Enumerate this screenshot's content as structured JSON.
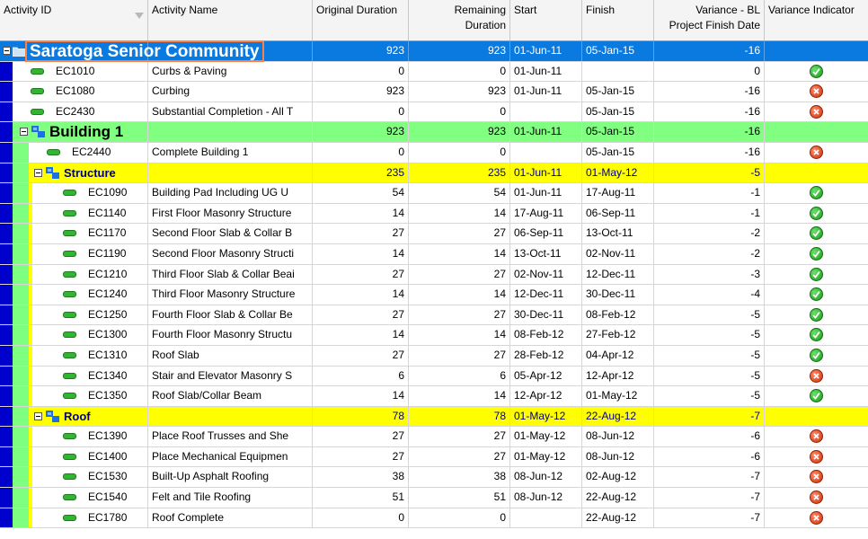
{
  "headers": {
    "activity_id": "Activity ID",
    "activity_name": "Activity Name",
    "original_duration": "Original Duration",
    "remaining_duration_1": "Remaining",
    "remaining_duration_2": "Duration",
    "start": "Start",
    "finish": "Finish",
    "variance_1": "Variance - BL",
    "variance_2": "Project Finish Date",
    "variance_indicator": "Variance Indicator"
  },
  "colors": {
    "project_band": "#0a79e0",
    "wbs1_band": "#80ff80",
    "wbs2_band": "#ffff00",
    "indicator_ok": "#22aa22",
    "indicator_bad": "#e0451a"
  },
  "rows": [
    {
      "type": "project",
      "id": "Saratoga Senior Community",
      "name": "",
      "od": "923",
      "rd": "923",
      "start": "01-Jun-11",
      "finish": "05-Jan-15",
      "var": "-16",
      "ind": ""
    },
    {
      "type": "activity",
      "level": 1,
      "id": "EC1010",
      "name": "Curbs & Paving",
      "od": "0",
      "rd": "0",
      "start": "01-Jun-11",
      "finish": "",
      "var": "0",
      "ind": "ok"
    },
    {
      "type": "activity",
      "level": 1,
      "id": "EC1080",
      "name": "Curbing",
      "od": "923",
      "rd": "923",
      "start": "01-Jun-11",
      "finish": "05-Jan-15",
      "var": "-16",
      "ind": "bad"
    },
    {
      "type": "activity",
      "level": 1,
      "id": "EC2430",
      "name": "Substantial Completion - All T",
      "od": "0",
      "rd": "0",
      "start": "",
      "finish": "05-Jan-15",
      "var": "-16",
      "ind": "bad"
    },
    {
      "type": "wbs1",
      "id": "Building 1",
      "name": "",
      "od": "923",
      "rd": "923",
      "start": "01-Jun-11",
      "finish": "05-Jan-15",
      "var": "-16",
      "ind": ""
    },
    {
      "type": "activity",
      "level": 2,
      "id": "EC2440",
      "name": "Complete Building 1",
      "od": "0",
      "rd": "0",
      "start": "",
      "finish": "05-Jan-15",
      "var": "-16",
      "ind": "bad"
    },
    {
      "type": "wbs2",
      "id": "Structure",
      "name": "",
      "od": "235",
      "rd": "235",
      "start": "01-Jun-11",
      "finish": "01-May-12",
      "var": "-5",
      "ind": ""
    },
    {
      "type": "activity",
      "level": 3,
      "id": "EC1090",
      "name": "Building Pad Including UG U",
      "od": "54",
      "rd": "54",
      "start": "01-Jun-11",
      "finish": "17-Aug-11",
      "var": "-1",
      "ind": "ok"
    },
    {
      "type": "activity",
      "level": 3,
      "id": "EC1140",
      "name": "First Floor Masonry Structure",
      "od": "14",
      "rd": "14",
      "start": "17-Aug-11",
      "finish": "06-Sep-11",
      "var": "-1",
      "ind": "ok"
    },
    {
      "type": "activity",
      "level": 3,
      "id": "EC1170",
      "name": "Second Floor Slab & Collar B",
      "od": "27",
      "rd": "27",
      "start": "06-Sep-11",
      "finish": "13-Oct-11",
      "var": "-2",
      "ind": "ok"
    },
    {
      "type": "activity",
      "level": 3,
      "id": "EC1190",
      "name": "Second Floor Masonry Structi",
      "od": "14",
      "rd": "14",
      "start": "13-Oct-11",
      "finish": "02-Nov-11",
      "var": "-2",
      "ind": "ok"
    },
    {
      "type": "activity",
      "level": 3,
      "id": "EC1210",
      "name": "Third Floor Slab & Collar Beai",
      "od": "27",
      "rd": "27",
      "start": "02-Nov-11",
      "finish": "12-Dec-11",
      "var": "-3",
      "ind": "ok"
    },
    {
      "type": "activity",
      "level": 3,
      "id": "EC1240",
      "name": "Third Floor Masonry Structure",
      "od": "14",
      "rd": "14",
      "start": "12-Dec-11",
      "finish": "30-Dec-11",
      "var": "-4",
      "ind": "ok"
    },
    {
      "type": "activity",
      "level": 3,
      "id": "EC1250",
      "name": "Fourth Floor Slab & Collar Be",
      "od": "27",
      "rd": "27",
      "start": "30-Dec-11",
      "finish": "08-Feb-12",
      "var": "-5",
      "ind": "ok"
    },
    {
      "type": "activity",
      "level": 3,
      "id": "EC1300",
      "name": "Fourth Floor Masonry Structu",
      "od": "14",
      "rd": "14",
      "start": "08-Feb-12",
      "finish": "27-Feb-12",
      "var": "-5",
      "ind": "ok"
    },
    {
      "type": "activity",
      "level": 3,
      "id": "EC1310",
      "name": "Roof Slab",
      "od": "27",
      "rd": "27",
      "start": "28-Feb-12",
      "finish": "04-Apr-12",
      "var": "-5",
      "ind": "ok"
    },
    {
      "type": "activity",
      "level": 3,
      "id": "EC1340",
      "name": "Stair and Elevator Masonry S",
      "od": "6",
      "rd": "6",
      "start": "05-Apr-12",
      "finish": "12-Apr-12",
      "var": "-5",
      "ind": "bad"
    },
    {
      "type": "activity",
      "level": 3,
      "id": "EC1350",
      "name": "Roof Slab/Collar Beam",
      "od": "14",
      "rd": "14",
      "start": "12-Apr-12",
      "finish": "01-May-12",
      "var": "-5",
      "ind": "ok"
    },
    {
      "type": "wbs2",
      "id": "Roof",
      "name": "",
      "od": "78",
      "rd": "78",
      "start": "01-May-12",
      "finish": "22-Aug-12",
      "var": "-7",
      "ind": ""
    },
    {
      "type": "activity",
      "level": 3,
      "id": "EC1390",
      "name": "Place Roof Trusses and She",
      "od": "27",
      "rd": "27",
      "start": "01-May-12",
      "finish": "08-Jun-12",
      "var": "-6",
      "ind": "bad"
    },
    {
      "type": "activity",
      "level": 3,
      "id": "EC1400",
      "name": "Place Mechanical Equipmen",
      "od": "27",
      "rd": "27",
      "start": "01-May-12",
      "finish": "08-Jun-12",
      "var": "-6",
      "ind": "bad"
    },
    {
      "type": "activity",
      "level": 3,
      "id": "EC1530",
      "name": "Built-Up Asphalt Roofing",
      "od": "38",
      "rd": "38",
      "start": "08-Jun-12",
      "finish": "02-Aug-12",
      "var": "-7",
      "ind": "bad"
    },
    {
      "type": "activity",
      "level": 3,
      "id": "EC1540",
      "name": "Felt and Tile Roofing",
      "od": "51",
      "rd": "51",
      "start": "08-Jun-12",
      "finish": "22-Aug-12",
      "var": "-7",
      "ind": "bad"
    },
    {
      "type": "activity",
      "level": 3,
      "id": "EC1780",
      "name": "Roof Complete",
      "od": "0",
      "rd": "0",
      "start": "",
      "finish": "22-Aug-12",
      "var": "-7",
      "ind": "bad"
    }
  ]
}
